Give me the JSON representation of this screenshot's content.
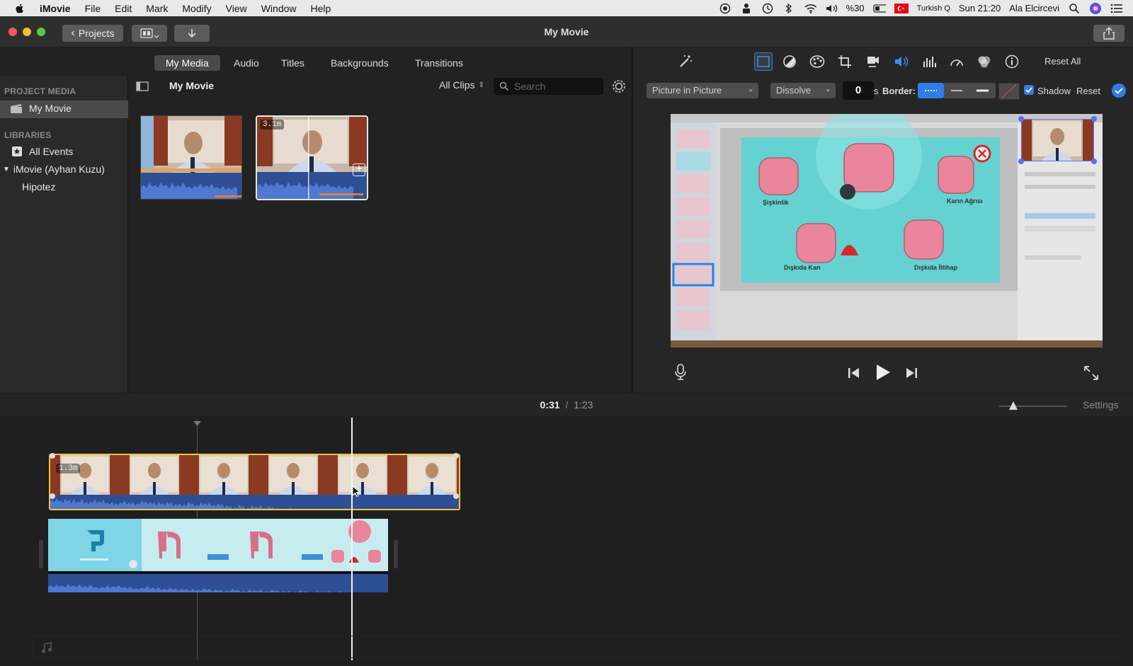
{
  "menubar": {
    "app": "iMovie",
    "items": [
      "File",
      "Edit",
      "Mark",
      "Modify",
      "View",
      "Window",
      "Help"
    ],
    "battery": "%30",
    "input_source": "Turkish Q",
    "clock": "Sun 21:20",
    "user": "Ala Elcircevi"
  },
  "window": {
    "title": "My Movie",
    "projects_button": "Projects"
  },
  "tabs": [
    "My Media",
    "Audio",
    "Titles",
    "Backgrounds",
    "Transitions"
  ],
  "sidebar": {
    "project_media_header": "PROJECT MEDIA",
    "project_item": "My Movie",
    "libraries_header": "LIBRARIES",
    "all_events": "All Events",
    "library": "iMovie (Ayhan Kuzu)",
    "event": "Hipotez"
  },
  "browser": {
    "title": "My Movie",
    "filter": "All Clips",
    "search_placeholder": "Search",
    "clip2_duration": "3.1m"
  },
  "inspector": {
    "overlay_style": "Picture in Picture",
    "transition": "Dissolve",
    "transition_duration": "0",
    "seconds_label": "s",
    "border_label": "Border:",
    "shadow_label": "Shadow",
    "reset_label": "Reset",
    "reset_all_label": "Reset All"
  },
  "slide": {
    "labels": [
      "Şişkinlik",
      "Karın Ağrısı",
      "Dışkıda Kan",
      "Dışkıda İltihap"
    ]
  },
  "timeline": {
    "current_time": "0:31",
    "separator": "/",
    "total_time": "1:23",
    "settings_label": "Settings",
    "top_clip_duration": "1.3m"
  },
  "colors": {
    "accent_blue": "#1e7ff0",
    "clip_selected_border": "#f2c437",
    "audio_wave": "#3c67b8"
  }
}
